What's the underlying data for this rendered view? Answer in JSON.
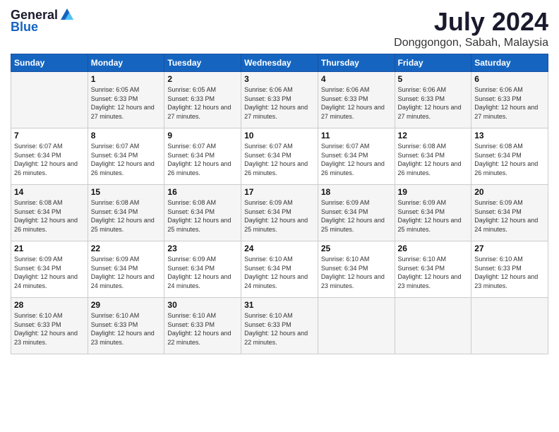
{
  "header": {
    "logo_general": "General",
    "logo_blue": "Blue",
    "title": "July 2024",
    "subtitle": "Donggongon, Sabah, Malaysia"
  },
  "days_of_week": [
    "Sunday",
    "Monday",
    "Tuesday",
    "Wednesday",
    "Thursday",
    "Friday",
    "Saturday"
  ],
  "weeks": [
    [
      {
        "day": "",
        "sunrise": "",
        "sunset": "",
        "daylight": ""
      },
      {
        "day": "1",
        "sunrise": "Sunrise: 6:05 AM",
        "sunset": "Sunset: 6:33 PM",
        "daylight": "Daylight: 12 hours and 27 minutes."
      },
      {
        "day": "2",
        "sunrise": "Sunrise: 6:05 AM",
        "sunset": "Sunset: 6:33 PM",
        "daylight": "Daylight: 12 hours and 27 minutes."
      },
      {
        "day": "3",
        "sunrise": "Sunrise: 6:06 AM",
        "sunset": "Sunset: 6:33 PM",
        "daylight": "Daylight: 12 hours and 27 minutes."
      },
      {
        "day": "4",
        "sunrise": "Sunrise: 6:06 AM",
        "sunset": "Sunset: 6:33 PM",
        "daylight": "Daylight: 12 hours and 27 minutes."
      },
      {
        "day": "5",
        "sunrise": "Sunrise: 6:06 AM",
        "sunset": "Sunset: 6:33 PM",
        "daylight": "Daylight: 12 hours and 27 minutes."
      },
      {
        "day": "6",
        "sunrise": "Sunrise: 6:06 AM",
        "sunset": "Sunset: 6:33 PM",
        "daylight": "Daylight: 12 hours and 27 minutes."
      }
    ],
    [
      {
        "day": "7",
        "sunrise": "Sunrise: 6:07 AM",
        "sunset": "Sunset: 6:34 PM",
        "daylight": "Daylight: 12 hours and 26 minutes."
      },
      {
        "day": "8",
        "sunrise": "Sunrise: 6:07 AM",
        "sunset": "Sunset: 6:34 PM",
        "daylight": "Daylight: 12 hours and 26 minutes."
      },
      {
        "day": "9",
        "sunrise": "Sunrise: 6:07 AM",
        "sunset": "Sunset: 6:34 PM",
        "daylight": "Daylight: 12 hours and 26 minutes."
      },
      {
        "day": "10",
        "sunrise": "Sunrise: 6:07 AM",
        "sunset": "Sunset: 6:34 PM",
        "daylight": "Daylight: 12 hours and 26 minutes."
      },
      {
        "day": "11",
        "sunrise": "Sunrise: 6:07 AM",
        "sunset": "Sunset: 6:34 PM",
        "daylight": "Daylight: 12 hours and 26 minutes."
      },
      {
        "day": "12",
        "sunrise": "Sunrise: 6:08 AM",
        "sunset": "Sunset: 6:34 PM",
        "daylight": "Daylight: 12 hours and 26 minutes."
      },
      {
        "day": "13",
        "sunrise": "Sunrise: 6:08 AM",
        "sunset": "Sunset: 6:34 PM",
        "daylight": "Daylight: 12 hours and 26 minutes."
      }
    ],
    [
      {
        "day": "14",
        "sunrise": "Sunrise: 6:08 AM",
        "sunset": "Sunset: 6:34 PM",
        "daylight": "Daylight: 12 hours and 26 minutes."
      },
      {
        "day": "15",
        "sunrise": "Sunrise: 6:08 AM",
        "sunset": "Sunset: 6:34 PM",
        "daylight": "Daylight: 12 hours and 25 minutes."
      },
      {
        "day": "16",
        "sunrise": "Sunrise: 6:08 AM",
        "sunset": "Sunset: 6:34 PM",
        "daylight": "Daylight: 12 hours and 25 minutes."
      },
      {
        "day": "17",
        "sunrise": "Sunrise: 6:09 AM",
        "sunset": "Sunset: 6:34 PM",
        "daylight": "Daylight: 12 hours and 25 minutes."
      },
      {
        "day": "18",
        "sunrise": "Sunrise: 6:09 AM",
        "sunset": "Sunset: 6:34 PM",
        "daylight": "Daylight: 12 hours and 25 minutes."
      },
      {
        "day": "19",
        "sunrise": "Sunrise: 6:09 AM",
        "sunset": "Sunset: 6:34 PM",
        "daylight": "Daylight: 12 hours and 25 minutes."
      },
      {
        "day": "20",
        "sunrise": "Sunrise: 6:09 AM",
        "sunset": "Sunset: 6:34 PM",
        "daylight": "Daylight: 12 hours and 24 minutes."
      }
    ],
    [
      {
        "day": "21",
        "sunrise": "Sunrise: 6:09 AM",
        "sunset": "Sunset: 6:34 PM",
        "daylight": "Daylight: 12 hours and 24 minutes."
      },
      {
        "day": "22",
        "sunrise": "Sunrise: 6:09 AM",
        "sunset": "Sunset: 6:34 PM",
        "daylight": "Daylight: 12 hours and 24 minutes."
      },
      {
        "day": "23",
        "sunrise": "Sunrise: 6:09 AM",
        "sunset": "Sunset: 6:34 PM",
        "daylight": "Daylight: 12 hours and 24 minutes."
      },
      {
        "day": "24",
        "sunrise": "Sunrise: 6:10 AM",
        "sunset": "Sunset: 6:34 PM",
        "daylight": "Daylight: 12 hours and 24 minutes."
      },
      {
        "day": "25",
        "sunrise": "Sunrise: 6:10 AM",
        "sunset": "Sunset: 6:34 PM",
        "daylight": "Daylight: 12 hours and 23 minutes."
      },
      {
        "day": "26",
        "sunrise": "Sunrise: 6:10 AM",
        "sunset": "Sunset: 6:34 PM",
        "daylight": "Daylight: 12 hours and 23 minutes."
      },
      {
        "day": "27",
        "sunrise": "Sunrise: 6:10 AM",
        "sunset": "Sunset: 6:33 PM",
        "daylight": "Daylight: 12 hours and 23 minutes."
      }
    ],
    [
      {
        "day": "28",
        "sunrise": "Sunrise: 6:10 AM",
        "sunset": "Sunset: 6:33 PM",
        "daylight": "Daylight: 12 hours and 23 minutes."
      },
      {
        "day": "29",
        "sunrise": "Sunrise: 6:10 AM",
        "sunset": "Sunset: 6:33 PM",
        "daylight": "Daylight: 12 hours and 23 minutes."
      },
      {
        "day": "30",
        "sunrise": "Sunrise: 6:10 AM",
        "sunset": "Sunset: 6:33 PM",
        "daylight": "Daylight: 12 hours and 22 minutes."
      },
      {
        "day": "31",
        "sunrise": "Sunrise: 6:10 AM",
        "sunset": "Sunset: 6:33 PM",
        "daylight": "Daylight: 12 hours and 22 minutes."
      },
      {
        "day": "",
        "sunrise": "",
        "sunset": "",
        "daylight": ""
      },
      {
        "day": "",
        "sunrise": "",
        "sunset": "",
        "daylight": ""
      },
      {
        "day": "",
        "sunrise": "",
        "sunset": "",
        "daylight": ""
      }
    ]
  ]
}
